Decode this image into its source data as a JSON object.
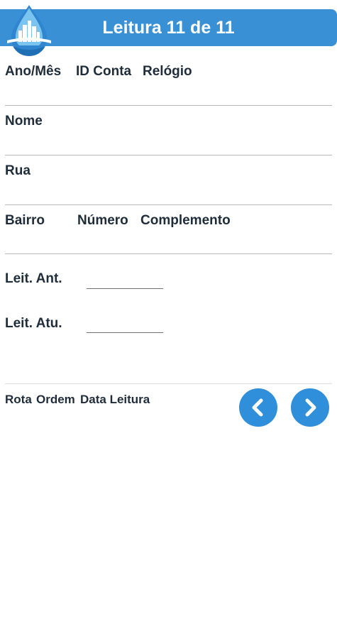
{
  "header": {
    "title": "Leitura 11 de 11"
  },
  "row1": {
    "ano_mes": "Ano/Mês",
    "id_conta": "ID Conta",
    "relogio": "Relógio"
  },
  "nome": "Nome",
  "rua": "Rua",
  "row4": {
    "bairro": "Bairro",
    "numero": "Número",
    "complemento": "Complemento"
  },
  "leituras": {
    "anterior_label": "Leit. Ant.",
    "atual_label": "Leit. Atu."
  },
  "footer": {
    "rota": "Rota",
    "ordem": "Ordem",
    "data_leitura": "Data Leitura"
  },
  "colors": {
    "accent": "#3a90d4",
    "button": "#2f8fdb"
  },
  "icons": {
    "logo": "water-drop-city-logo",
    "prev": "chevron-left-icon",
    "next": "chevron-right-icon"
  }
}
